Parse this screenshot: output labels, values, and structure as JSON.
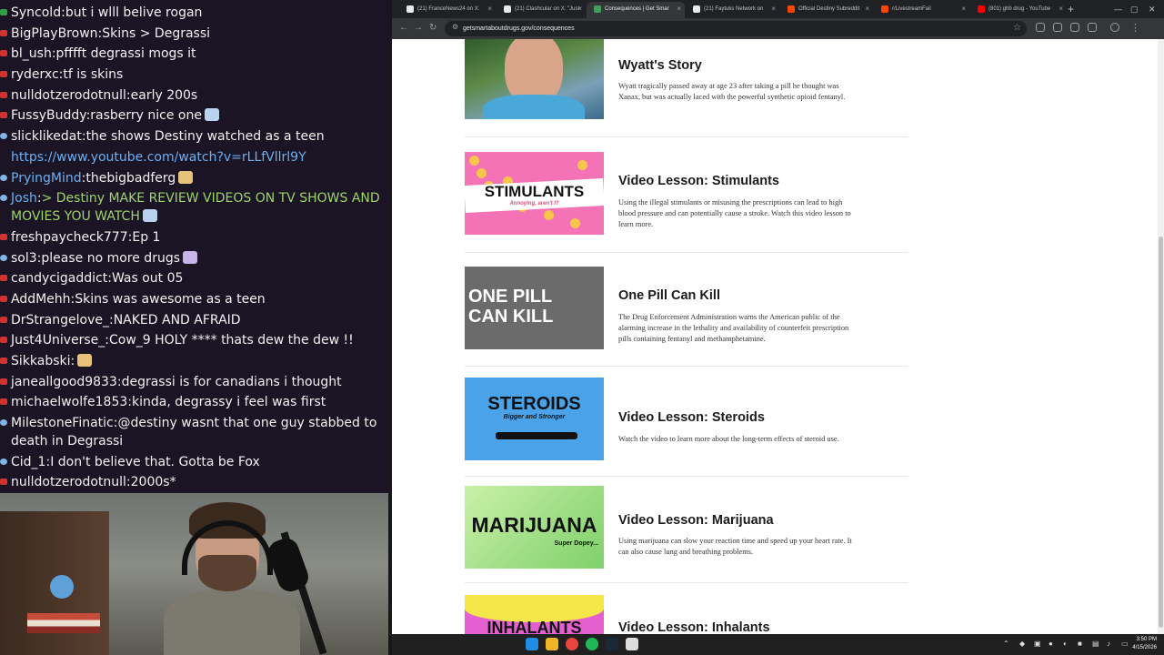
{
  "chat": {
    "messages": [
      {
        "badge": "green",
        "user": "Syncold",
        "text": "but i wlll belive rogan"
      },
      {
        "badge": "red",
        "user": "BigPlayBrown",
        "text": "Skins > Degrassi"
      },
      {
        "badge": "red",
        "user": "bl_ush",
        "text": "pfffft degrassi mogs it"
      },
      {
        "badge": "red",
        "user": "ryderxc",
        "text": "tf is skins"
      },
      {
        "badge": "red",
        "user": "nulldotzerodotnull",
        "text": "early 200s"
      },
      {
        "badge": "red",
        "user": "FussyBuddy",
        "text": "rasberry nice one"
      },
      {
        "badge": "blue",
        "user": "slicklikedat",
        "text": "the shows Destiny watched as a teen"
      },
      {
        "badge": "",
        "user": "",
        "text": "https://www.youtube.com/watch?v=rLLfVllrl9Y",
        "link": true
      },
      {
        "badge": "blue",
        "user": "PryingMind",
        "text": "thebigbadferg",
        "userblue": true
      },
      {
        "badge": "blue",
        "user": "Josh",
        "text": "> Destiny MAKE REVIEW VIDEOS ON TV SHOWS AND MOVIES YOU WATCH",
        "userblue": true,
        "green": true
      },
      {
        "badge": "red",
        "user": "freshpaycheck777",
        "text": "Ep 1"
      },
      {
        "badge": "blue",
        "user": "sol3",
        "text": "please no more drugs"
      },
      {
        "badge": "red",
        "user": "candycigaddict",
        "text": "Was out 05"
      },
      {
        "badge": "red",
        "user": "AddMehh",
        "text": "Skins was awesome as a teen"
      },
      {
        "badge": "red",
        "user": "DrStrangelove_",
        "text": "NAKED AND AFRAID"
      },
      {
        "badge": "red",
        "user": "Just4Universe_",
        "text": "Cow_9 HOLY **** thats dew the dew !!"
      },
      {
        "badge": "red",
        "user": "Sikkabski",
        "text": ""
      },
      {
        "badge": "red",
        "user": "janeallgood9833",
        "text": "degrassi is for canadians i thought"
      },
      {
        "badge": "red",
        "user": "michaelwolfe1853",
        "text": "kinda, degrassy i feel was first"
      },
      {
        "badge": "blue",
        "user": "MilestoneFinatic",
        "text": "@destiny wasnt that one guy stabbed to death in Degrassi"
      },
      {
        "badge": "blue",
        "user": "Cid_1",
        "text": "I don't believe that. Gotta be Fox"
      },
      {
        "badge": "red",
        "user": "nulldotzerodotnull",
        "text": "2000s*"
      }
    ]
  },
  "browser": {
    "tabs": [
      {
        "label": "(21) FranceNews24 on X:",
        "fav": "#e8eaed"
      },
      {
        "label": "(21) Clashcular on X: \"Just",
        "fav": "#e8eaed"
      },
      {
        "label": "Consequences | Get Smar",
        "fav": "#3ea05a",
        "active": true
      },
      {
        "label": "(21) Faytuks Network on",
        "fav": "#e8eaed"
      },
      {
        "label": "Official Destiny Subreddit",
        "fav": "#ff4500"
      },
      {
        "label": "r/LivestreamFail",
        "fav": "#ff4500"
      },
      {
        "label": "(801) ghb drug - YouTube",
        "fav": "#ff0000"
      }
    ],
    "url": "getsmartaboutdrugs.gov/consequences"
  },
  "cards": [
    {
      "title": "Wyatt's Story",
      "desc": "Wyatt tragically passed away at age 23 after taking a pill he thought was Xanax, but was actually laced with the powerful synthetic opioid fentanyl.",
      "thumb_label": "",
      "thumb_sub": ""
    },
    {
      "title": "Video Lesson: Stimulants",
      "desc": "Using the illegal stimulants or misusing the prescriptions can lead to high blood pressure and can potentially cause a stroke. Watch this video lesson to learn more.",
      "thumb_label": "STIMULANTS",
      "thumb_sub": "Annoying, aren't I?"
    },
    {
      "title": "One Pill Can Kill",
      "desc": "The Drug Enforcement Administration warns the American public of the alarming increase in the lethality and availability of counterfeit prescription pills containing fentanyl and methamphetamine.",
      "thumb_label": "ONE PILL CAN KILL",
      "thumb_sub": ""
    },
    {
      "title": "Video Lesson: Steroids",
      "desc": "Watch the video to learn more about the long-term effects of steroid use.",
      "thumb_label": "STEROIDS",
      "thumb_sub": "Bigger and Stronger"
    },
    {
      "title": "Video Lesson: Marijuana",
      "desc": "Using marijuana can slow your reaction time and speed up your heart rate. It can also cause lung and breathing problems.",
      "thumb_label": "MARIJUANA",
      "thumb_sub": "Super Dopey..."
    },
    {
      "title": "Video Lesson: Inhalants",
      "desc": "",
      "thumb_label": "INHALANTS",
      "thumb_sub": ""
    }
  ],
  "taskbar": {
    "time": "3:50 PM",
    "date": "4/15/2026"
  }
}
